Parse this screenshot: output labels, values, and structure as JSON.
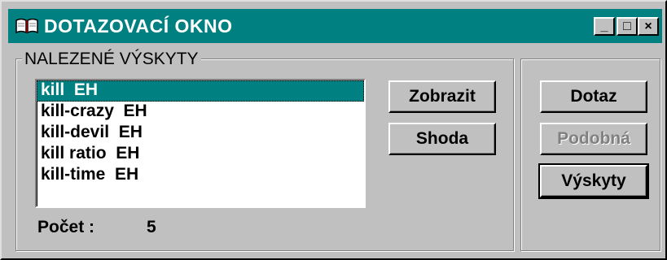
{
  "window": {
    "title": "DOTAZOVACÍ OKNO",
    "icon": "book-icon",
    "controls": {
      "minimize": "_",
      "maximize": "□",
      "close": "×"
    }
  },
  "group": {
    "label": "NALEZENÉ VÝSKYTY"
  },
  "list": {
    "items": [
      "kill  EH",
      "kill-crazy  EH",
      "kill-devil  EH",
      "kill ratio  EH",
      "kill-time  EH"
    ],
    "selected_index": 0
  },
  "buttons": {
    "zobrazit": "Zobrazit",
    "shoda": "Shoda",
    "dotaz": "Dotaz",
    "podobna": "Podobná",
    "vyskyty": "Výskyty"
  },
  "count": {
    "label": "Počet :",
    "value": "5"
  },
  "colors": {
    "title_bg": "#008080",
    "face": "#c0c0c0",
    "selection": "#008080"
  }
}
